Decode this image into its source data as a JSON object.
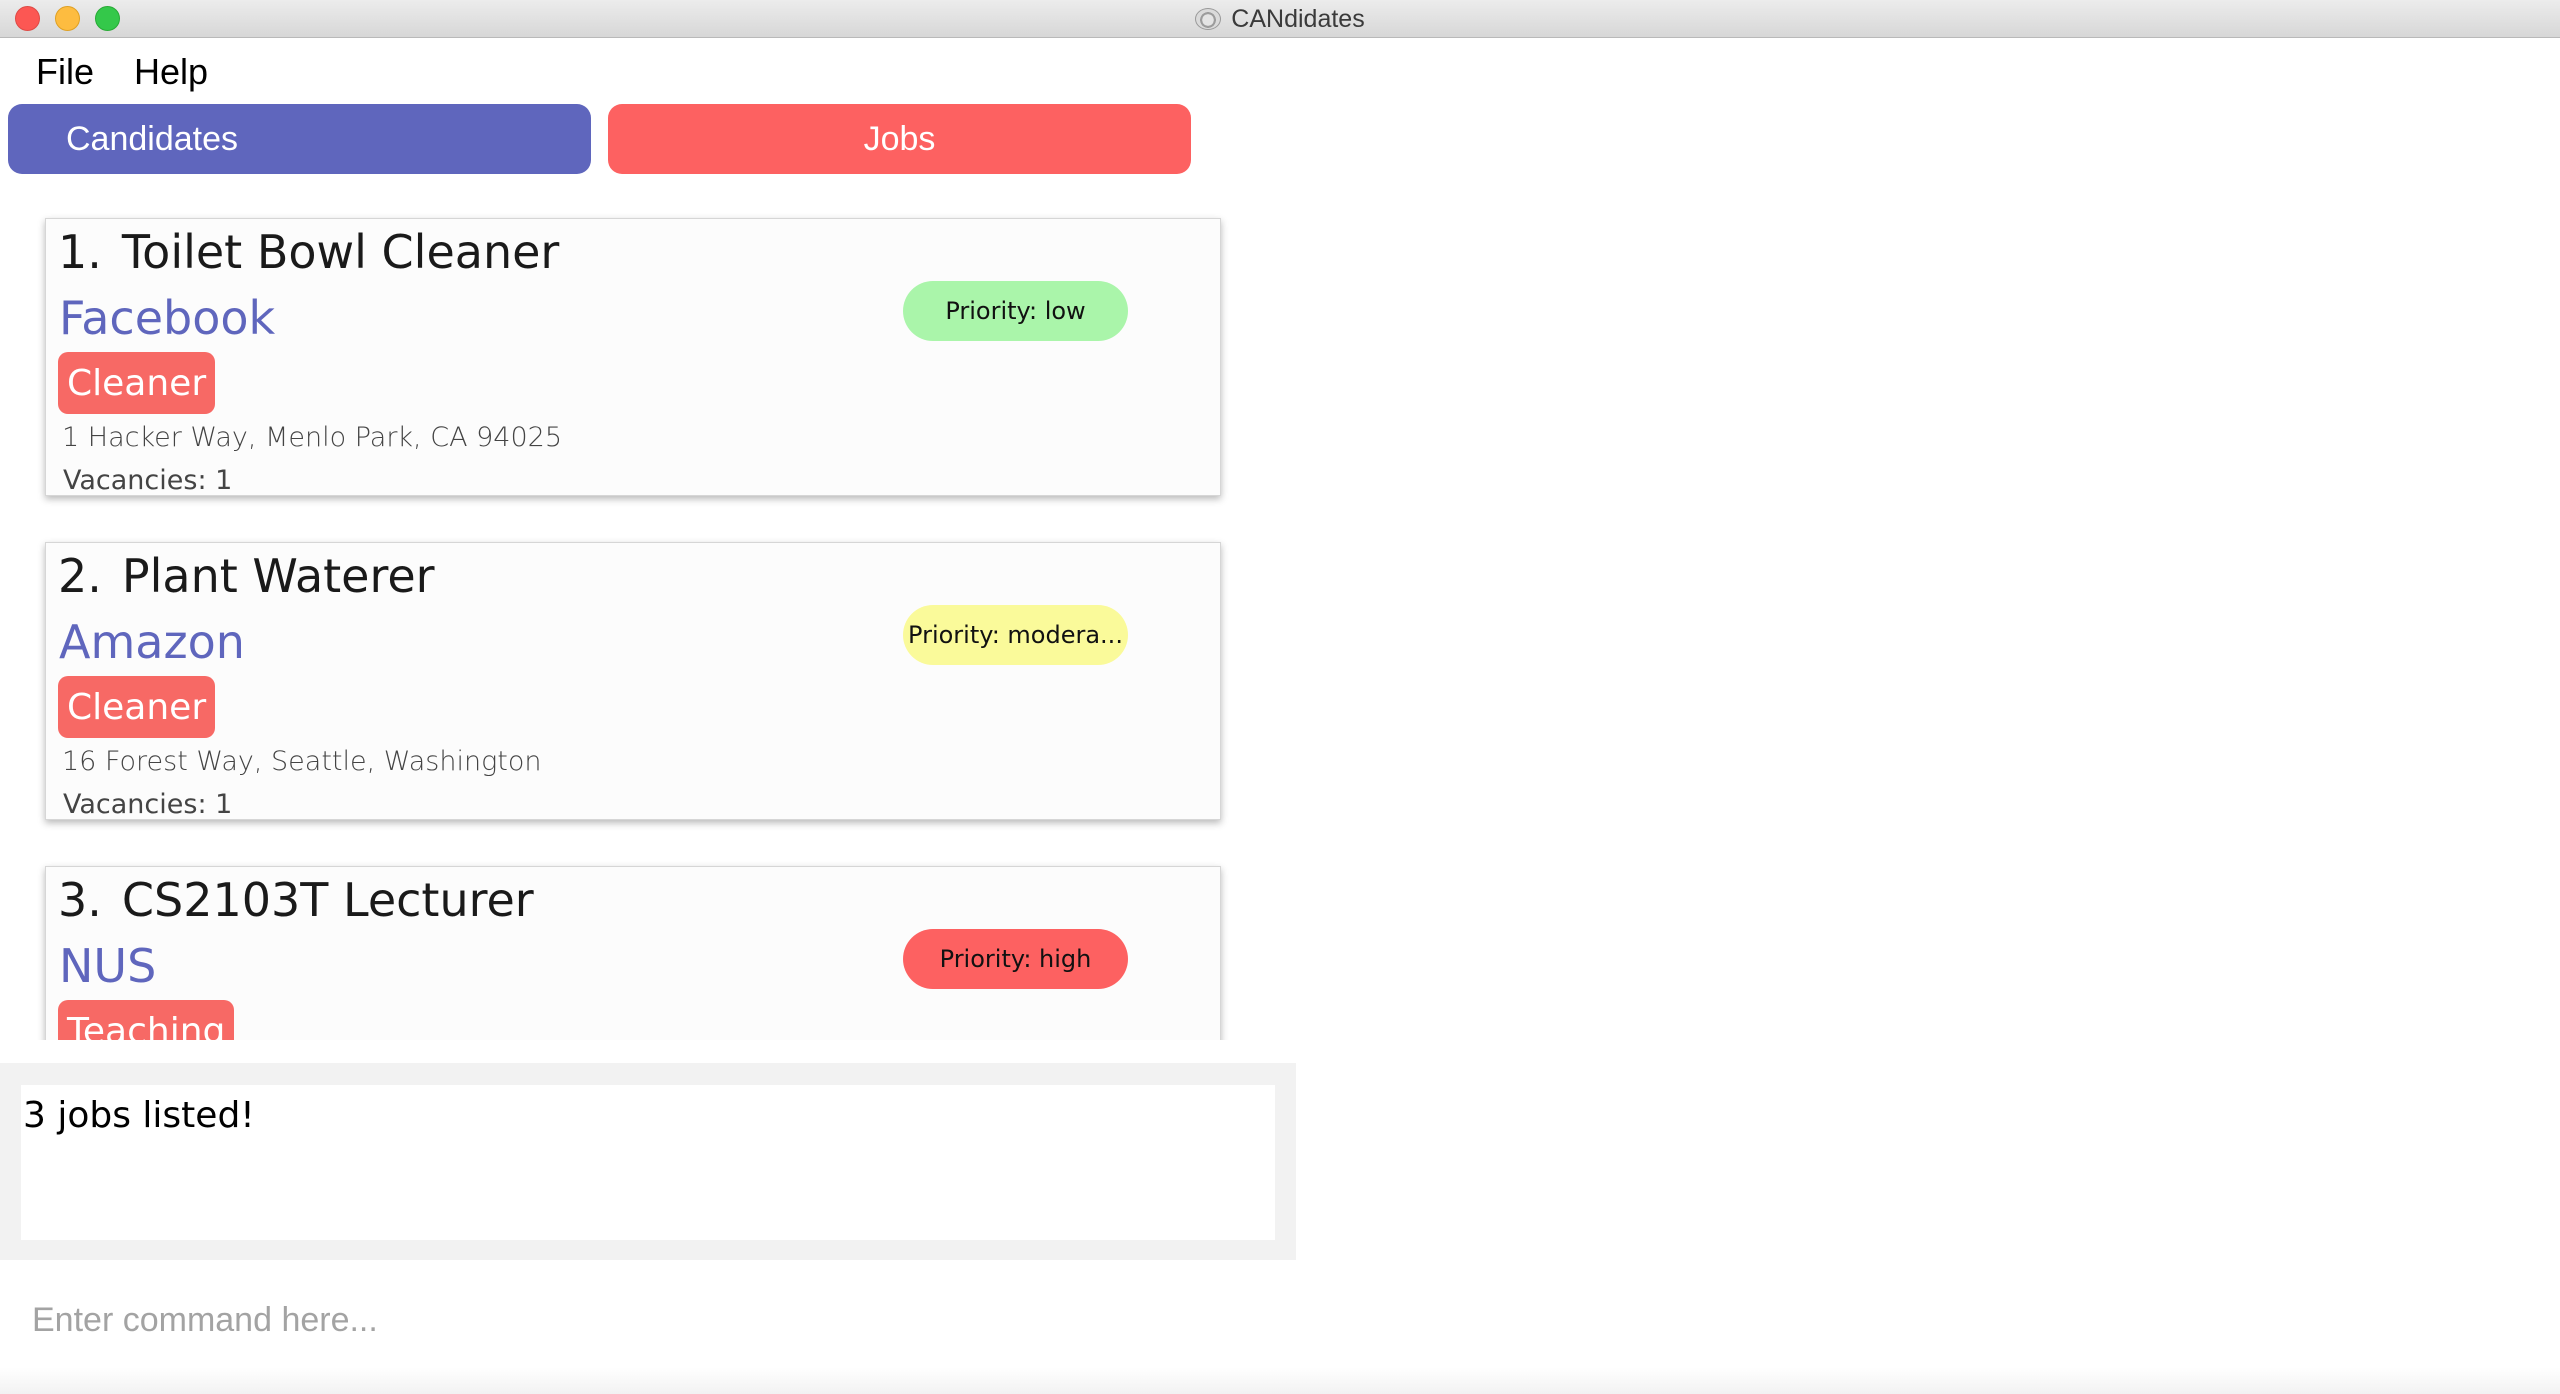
{
  "window": {
    "title": "CANdidates",
    "app_icon": "app-logo-icon"
  },
  "menu": {
    "items": [
      "File",
      "Help"
    ]
  },
  "tabs": {
    "candidates": "Candidates",
    "jobs": "Jobs",
    "active": "jobs"
  },
  "jobs": [
    {
      "index": "1.",
      "title": "Toilet Bowl Cleaner",
      "company": "Facebook",
      "tag": "Cleaner",
      "address": "1 Hacker Way, Menlo Park, CA 94025",
      "vacancies": "Vacancies: 1",
      "priority": "Priority: low",
      "priority_color": "#aaf5aa"
    },
    {
      "index": "2.",
      "title": "Plant Waterer",
      "company": "Amazon",
      "tag": "Cleaner",
      "address": "16 Forest Way, Seattle, Washington",
      "vacancies": "Vacancies: 1",
      "priority": "Priority: modera...",
      "priority_color": "#fafa9a"
    },
    {
      "index": "3.",
      "title": "CS2103T Lecturer",
      "company": "NUS",
      "tag": "Teaching",
      "priority": "Priority: high",
      "priority_color": "#fd6161"
    }
  ],
  "result": {
    "text": "3 jobs listed!"
  },
  "command": {
    "placeholder": "Enter command here...",
    "value": ""
  },
  "colors": {
    "primary": "#5f66bd",
    "accent": "#fd6161",
    "tag": "#f76965"
  }
}
